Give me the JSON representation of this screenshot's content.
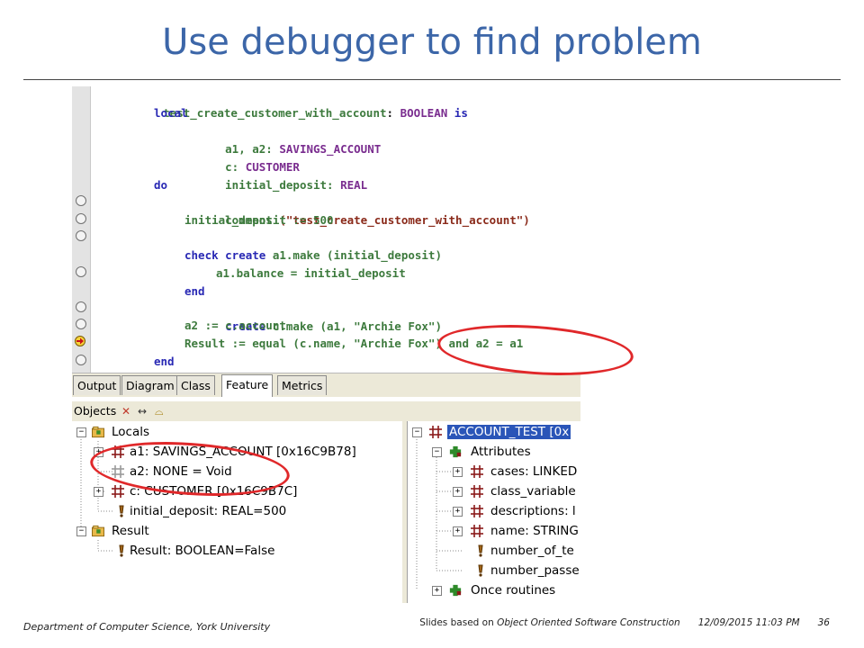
{
  "slide": {
    "title": "Use debugger to find problem",
    "footer_left": "Department of Computer Science, York University",
    "footer_prefix": "Slides based on ",
    "footer_book": "Object Oriented Software Construction",
    "footer_date": "12/09/2015 11:03 PM",
    "footer_page": "36"
  },
  "code": {
    "feature_name": "test_create_customer_with_account",
    "line1_type": "BOOLEAN",
    "line1_is": "is",
    "local_kw": "local",
    "decl1_names": "a1, a2:",
    "decl1_type": "SAVINGS_ACCOUNT",
    "decl2_name": "c:",
    "decl2_type": "CUSTOMER",
    "decl3_name": "initial_deposit:",
    "decl3_type": "REAL",
    "do_kw": "do",
    "comment_call": "comment",
    "comment_arg": "(\"test_create_customer_with_account\")",
    "assign1": "initial_deposit := 500",
    "create1_kw": "create",
    "create1_rest": "a1.make (initial_deposit)",
    "check_kw": "check",
    "check_expr": "a1.balance = initial_deposit",
    "end1": "end",
    "create2_kw": "create",
    "create2_rest": "c.make (a1, \"Archie Fox\")",
    "assign2": "a2 := c.account",
    "result_line": "Result := equal (c.name, \"Archie Fox\") and a2 = a1",
    "end2": "end"
  },
  "tabs": [
    "Output",
    "Diagram",
    "Class",
    "Feature",
    "Metrics"
  ],
  "active_tab": "Feature",
  "objects_bar": {
    "label": "Objects",
    "close_icon": "close-icon",
    "swap_icon": "arrows-icon",
    "filter_icon": "filter-icon"
  },
  "locals_tree": {
    "locals": "Locals",
    "a1": "a1: SAVINGS_ACCOUNT [0x16C9B78]",
    "a2": "a2: NONE = Void",
    "c": "c: CUSTOMER [0x16C9B7C]",
    "initial_deposit": "initial_deposit: REAL=500",
    "result_group": "Result",
    "result_value": "Result: BOOLEAN=False"
  },
  "object_tree": {
    "root": "ACCOUNT_TEST [0x",
    "attributes": "Attributes",
    "items": [
      "cases: LINKED",
      "class_variable",
      "descriptions: l",
      "name: STRING",
      "number_of_te",
      "number_passe"
    ],
    "once": "Once routines"
  },
  "colors": {
    "title": "#3c66a8",
    "keyword": "#2828b4",
    "identifier": "#3d7a3d",
    "type": "#7a2d8f",
    "annotation": "#e0282a",
    "selection": "#2a55b8"
  }
}
